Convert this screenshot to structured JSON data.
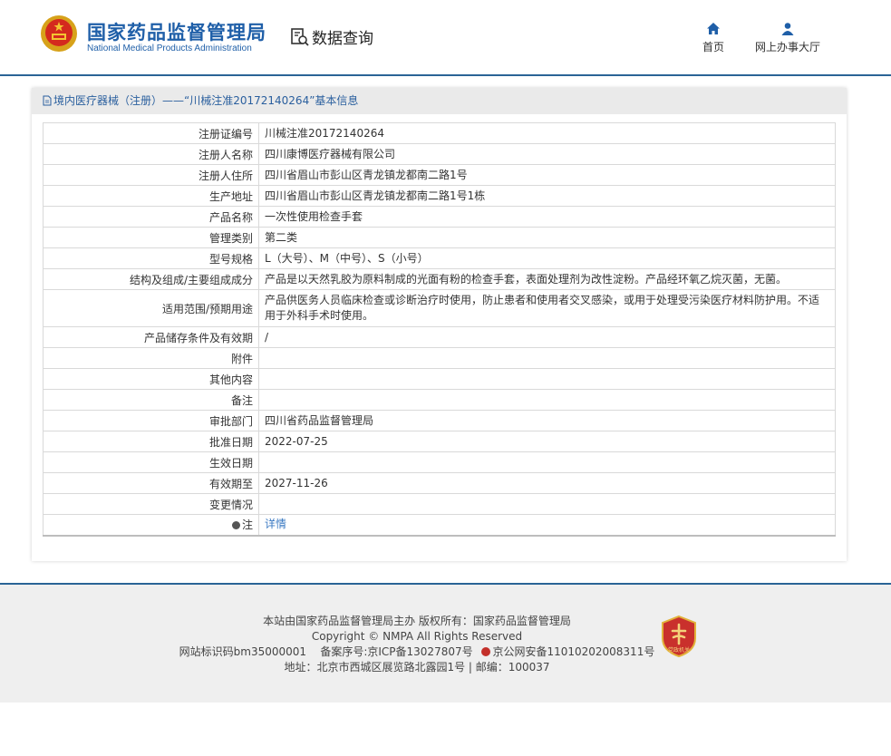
{
  "header": {
    "site_name_cn": "国家药品监督管理局",
    "site_name_en": "National Medical Products Administration",
    "data_query_label": "数据查询",
    "nav": [
      {
        "label": "首页",
        "icon": "home-icon"
      },
      {
        "label": "网上办事大厅",
        "icon": "user-icon"
      }
    ]
  },
  "panel": {
    "title": "境内医疗器械（注册）——“川械注准20172140264”基本信息"
  },
  "rows": [
    {
      "key": "注册证编号",
      "value": "川械注准20172140264"
    },
    {
      "key": "注册人名称",
      "value": "四川康博医疗器械有限公司"
    },
    {
      "key": "注册人住所",
      "value": "四川省眉山市彭山区青龙镇龙都南二路1号"
    },
    {
      "key": "生产地址",
      "value": "四川省眉山市彭山区青龙镇龙都南二路1号1栋"
    },
    {
      "key": "产品名称",
      "value": "一次性使用检查手套"
    },
    {
      "key": "管理类别",
      "value": "第二类"
    },
    {
      "key": "型号规格",
      "value": "L（大号）、M（中号）、S（小号）"
    },
    {
      "key": "结构及组成/主要组成成分",
      "value": "产品是以天然乳胶为原料制成的光面有粉的检查手套，表面处理剂为改性淀粉。产品经环氧乙烷灭菌，无菌。"
    },
    {
      "key": "适用范围/预期用途",
      "value": "产品供医务人员临床检查或诊断治疗时使用，防止患者和使用者交叉感染，或用于处理受污染医疗材料防护用。不适用于外科手术时使用。"
    },
    {
      "key": "产品储存条件及有效期",
      "value": "/"
    },
    {
      "key": "附件",
      "value": ""
    },
    {
      "key": "其他内容",
      "value": ""
    },
    {
      "key": "备注",
      "value": ""
    },
    {
      "key": "审批部门",
      "value": "四川省药品监督管理局"
    },
    {
      "key": "批准日期",
      "value": "2022-07-25"
    },
    {
      "key": "生效日期",
      "value": ""
    },
    {
      "key": "有效期至",
      "value": "2027-11-26"
    },
    {
      "key": "变更情况",
      "value": ""
    },
    {
      "key": "注",
      "value": "详情"
    }
  ],
  "footer": {
    "line1": "本站由国家药品监督管理局主办 版权所有：国家药品监督管理局",
    "line2": "Copyright © NMPA All Rights Reserved",
    "site_id": "网站标识码bm35000001",
    "icp": "备案序号:京ICP备13027807号",
    "police": "京公网安备11010202008311号",
    "address": "地址：北京市西城区展览路北露园1号 | 邮编：100037",
    "badge_text": "党政机关"
  },
  "colors": {
    "brand_blue": "#1f5fa8",
    "header_line": "#2a6496",
    "link": "#3a79c2"
  }
}
